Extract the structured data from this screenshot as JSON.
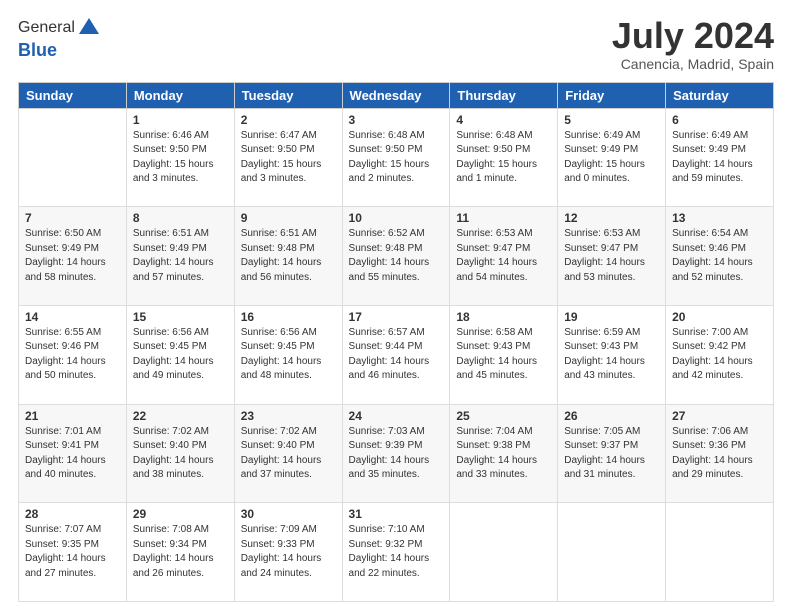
{
  "header": {
    "logo": {
      "line1": "General",
      "line2": "Blue"
    },
    "title": "July 2024",
    "location": "Canencia, Madrid, Spain"
  },
  "weekdays": [
    "Sunday",
    "Monday",
    "Tuesday",
    "Wednesday",
    "Thursday",
    "Friday",
    "Saturday"
  ],
  "weeks": [
    [
      {
        "day": null,
        "sunrise": null,
        "sunset": null,
        "daylight": null
      },
      {
        "day": "1",
        "sunrise": "Sunrise: 6:46 AM",
        "sunset": "Sunset: 9:50 PM",
        "daylight": "Daylight: 15 hours and 3 minutes."
      },
      {
        "day": "2",
        "sunrise": "Sunrise: 6:47 AM",
        "sunset": "Sunset: 9:50 PM",
        "daylight": "Daylight: 15 hours and 3 minutes."
      },
      {
        "day": "3",
        "sunrise": "Sunrise: 6:48 AM",
        "sunset": "Sunset: 9:50 PM",
        "daylight": "Daylight: 15 hours and 2 minutes."
      },
      {
        "day": "4",
        "sunrise": "Sunrise: 6:48 AM",
        "sunset": "Sunset: 9:50 PM",
        "daylight": "Daylight: 15 hours and 1 minute."
      },
      {
        "day": "5",
        "sunrise": "Sunrise: 6:49 AM",
        "sunset": "Sunset: 9:49 PM",
        "daylight": "Daylight: 15 hours and 0 minutes."
      },
      {
        "day": "6",
        "sunrise": "Sunrise: 6:49 AM",
        "sunset": "Sunset: 9:49 PM",
        "daylight": "Daylight: 14 hours and 59 minutes."
      }
    ],
    [
      {
        "day": "7",
        "sunrise": "Sunrise: 6:50 AM",
        "sunset": "Sunset: 9:49 PM",
        "daylight": "Daylight: 14 hours and 58 minutes."
      },
      {
        "day": "8",
        "sunrise": "Sunrise: 6:51 AM",
        "sunset": "Sunset: 9:49 PM",
        "daylight": "Daylight: 14 hours and 57 minutes."
      },
      {
        "day": "9",
        "sunrise": "Sunrise: 6:51 AM",
        "sunset": "Sunset: 9:48 PM",
        "daylight": "Daylight: 14 hours and 56 minutes."
      },
      {
        "day": "10",
        "sunrise": "Sunrise: 6:52 AM",
        "sunset": "Sunset: 9:48 PM",
        "daylight": "Daylight: 14 hours and 55 minutes."
      },
      {
        "day": "11",
        "sunrise": "Sunrise: 6:53 AM",
        "sunset": "Sunset: 9:47 PM",
        "daylight": "Daylight: 14 hours and 54 minutes."
      },
      {
        "day": "12",
        "sunrise": "Sunrise: 6:53 AM",
        "sunset": "Sunset: 9:47 PM",
        "daylight": "Daylight: 14 hours and 53 minutes."
      },
      {
        "day": "13",
        "sunrise": "Sunrise: 6:54 AM",
        "sunset": "Sunset: 9:46 PM",
        "daylight": "Daylight: 14 hours and 52 minutes."
      }
    ],
    [
      {
        "day": "14",
        "sunrise": "Sunrise: 6:55 AM",
        "sunset": "Sunset: 9:46 PM",
        "daylight": "Daylight: 14 hours and 50 minutes."
      },
      {
        "day": "15",
        "sunrise": "Sunrise: 6:56 AM",
        "sunset": "Sunset: 9:45 PM",
        "daylight": "Daylight: 14 hours and 49 minutes."
      },
      {
        "day": "16",
        "sunrise": "Sunrise: 6:56 AM",
        "sunset": "Sunset: 9:45 PM",
        "daylight": "Daylight: 14 hours and 48 minutes."
      },
      {
        "day": "17",
        "sunrise": "Sunrise: 6:57 AM",
        "sunset": "Sunset: 9:44 PM",
        "daylight": "Daylight: 14 hours and 46 minutes."
      },
      {
        "day": "18",
        "sunrise": "Sunrise: 6:58 AM",
        "sunset": "Sunset: 9:43 PM",
        "daylight": "Daylight: 14 hours and 45 minutes."
      },
      {
        "day": "19",
        "sunrise": "Sunrise: 6:59 AM",
        "sunset": "Sunset: 9:43 PM",
        "daylight": "Daylight: 14 hours and 43 minutes."
      },
      {
        "day": "20",
        "sunrise": "Sunrise: 7:00 AM",
        "sunset": "Sunset: 9:42 PM",
        "daylight": "Daylight: 14 hours and 42 minutes."
      }
    ],
    [
      {
        "day": "21",
        "sunrise": "Sunrise: 7:01 AM",
        "sunset": "Sunset: 9:41 PM",
        "daylight": "Daylight: 14 hours and 40 minutes."
      },
      {
        "day": "22",
        "sunrise": "Sunrise: 7:02 AM",
        "sunset": "Sunset: 9:40 PM",
        "daylight": "Daylight: 14 hours and 38 minutes."
      },
      {
        "day": "23",
        "sunrise": "Sunrise: 7:02 AM",
        "sunset": "Sunset: 9:40 PM",
        "daylight": "Daylight: 14 hours and 37 minutes."
      },
      {
        "day": "24",
        "sunrise": "Sunrise: 7:03 AM",
        "sunset": "Sunset: 9:39 PM",
        "daylight": "Daylight: 14 hours and 35 minutes."
      },
      {
        "day": "25",
        "sunrise": "Sunrise: 7:04 AM",
        "sunset": "Sunset: 9:38 PM",
        "daylight": "Daylight: 14 hours and 33 minutes."
      },
      {
        "day": "26",
        "sunrise": "Sunrise: 7:05 AM",
        "sunset": "Sunset: 9:37 PM",
        "daylight": "Daylight: 14 hours and 31 minutes."
      },
      {
        "day": "27",
        "sunrise": "Sunrise: 7:06 AM",
        "sunset": "Sunset: 9:36 PM",
        "daylight": "Daylight: 14 hours and 29 minutes."
      }
    ],
    [
      {
        "day": "28",
        "sunrise": "Sunrise: 7:07 AM",
        "sunset": "Sunset: 9:35 PM",
        "daylight": "Daylight: 14 hours and 27 minutes."
      },
      {
        "day": "29",
        "sunrise": "Sunrise: 7:08 AM",
        "sunset": "Sunset: 9:34 PM",
        "daylight": "Daylight: 14 hours and 26 minutes."
      },
      {
        "day": "30",
        "sunrise": "Sunrise: 7:09 AM",
        "sunset": "Sunset: 9:33 PM",
        "daylight": "Daylight: 14 hours and 24 minutes."
      },
      {
        "day": "31",
        "sunrise": "Sunrise: 7:10 AM",
        "sunset": "Sunset: 9:32 PM",
        "daylight": "Daylight: 14 hours and 22 minutes."
      },
      {
        "day": null,
        "sunrise": null,
        "sunset": null,
        "daylight": null
      },
      {
        "day": null,
        "sunrise": null,
        "sunset": null,
        "daylight": null
      },
      {
        "day": null,
        "sunrise": null,
        "sunset": null,
        "daylight": null
      }
    ]
  ]
}
